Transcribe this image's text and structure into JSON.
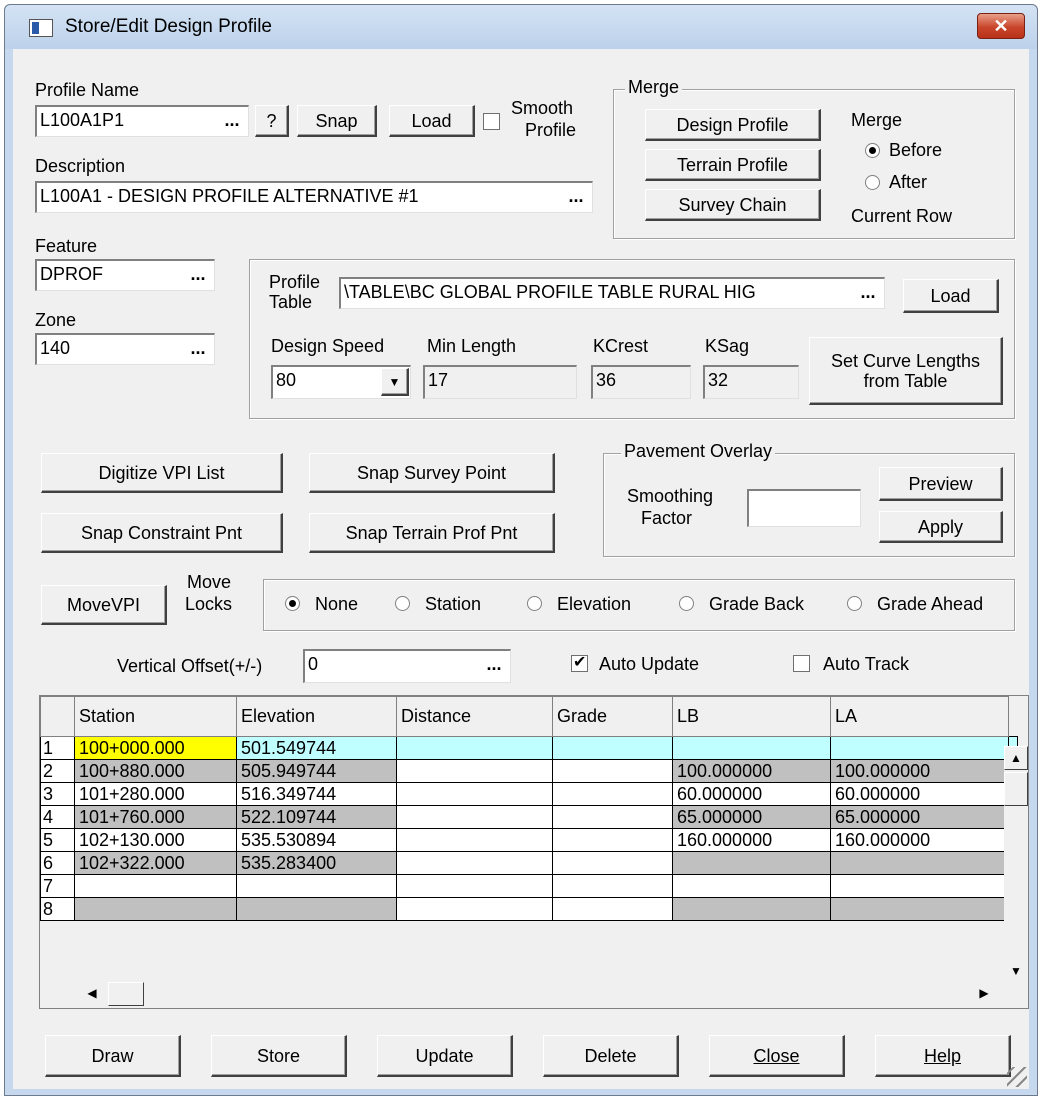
{
  "window": {
    "title": "Store/Edit Design Profile",
    "close_glyph": "✕"
  },
  "profile": {
    "name_label": "Profile Name",
    "name_value": "L100A1P1",
    "ellipsis": "...",
    "help_label": "?",
    "snap_label": "Snap",
    "load_label": "Load",
    "smooth_label_1": "Smooth",
    "smooth_label_2": "Profile",
    "smooth_checked": false,
    "description_label": "Description",
    "description_value": "L100A1 - DESIGN PROFILE ALTERNATIVE #1"
  },
  "merge": {
    "group_title": "Merge",
    "design_profile_label": "Design Profile",
    "terrain_profile_label": "Terrain Profile",
    "survey_chain_label": "Survey Chain",
    "merge_label": "Merge",
    "before_label": "Before",
    "after_label": "After",
    "current_row_label": "Current Row",
    "selected": "Before"
  },
  "feature": {
    "label": "Feature",
    "value": "DPROF"
  },
  "zone": {
    "label": "Zone",
    "value": "140"
  },
  "profile_table": {
    "label_1": "Profile",
    "label_2": "Table",
    "value": "\\TABLE\\BC GLOBAL PROFILE TABLE RURAL HIG",
    "load_label": "Load",
    "design_speed_label": "Design Speed",
    "design_speed_value": "80",
    "min_length_label": "Min Length",
    "min_length_value": "17",
    "kcrest_label": "KCrest",
    "kcrest_value": "36",
    "ksag_label": "KSag",
    "ksag_value": "32",
    "set_curve_label_1": "Set Curve Lengths",
    "set_curve_label_2": "from Table"
  },
  "buttons": {
    "digitize_vpi": "Digitize VPI List",
    "snap_survey_point": "Snap Survey Point",
    "snap_constraint": "Snap Constraint Pnt",
    "snap_terrain": "Snap Terrain Prof Pnt",
    "move_vpi": "MoveVPI"
  },
  "pavement": {
    "group_title": "Pavement Overlay",
    "smoothing_label_1": "Smoothing",
    "smoothing_label_2": "Factor",
    "smoothing_value": "",
    "preview_label": "Preview",
    "apply_label": "Apply"
  },
  "move_locks": {
    "label_1": "Move",
    "label_2": "Locks",
    "options": [
      "None",
      "Station",
      "Elevation",
      "Grade Back",
      "Grade Ahead"
    ],
    "selected": "None"
  },
  "offset": {
    "label": "Vertical Offset(+/-)",
    "value": "0",
    "auto_update_label": "Auto Update",
    "auto_update_checked": true,
    "auto_track_label": "Auto Track",
    "auto_track_checked": false
  },
  "grid": {
    "columns": [
      "Station",
      "Elevation",
      "Distance",
      "Grade",
      "LB",
      "LA"
    ],
    "rows": [
      {
        "n": "1",
        "cells": [
          "100+000.000",
          "501.549744",
          "",
          "",
          "",
          ""
        ]
      },
      {
        "n": "2",
        "cells": [
          "100+880.000",
          "505.949744",
          "",
          "",
          "100.000000",
          "100.000000"
        ]
      },
      {
        "n": "3",
        "cells": [
          "101+280.000",
          "516.349744",
          "",
          "",
          "60.000000",
          "60.000000"
        ]
      },
      {
        "n": "4",
        "cells": [
          "101+760.000",
          "522.109744",
          "",
          "",
          "65.000000",
          "65.000000"
        ]
      },
      {
        "n": "5",
        "cells": [
          "102+130.000",
          "535.530894",
          "",
          "",
          "160.000000",
          "160.000000"
        ]
      },
      {
        "n": "6",
        "cells": [
          "102+322.000",
          "535.283400",
          "",
          "",
          "",
          ""
        ]
      },
      {
        "n": "7",
        "cells": [
          "",
          "",
          "",
          "",
          "",
          ""
        ]
      },
      {
        "n": "8",
        "cells": [
          "",
          "",
          "",
          "",
          "",
          ""
        ]
      }
    ],
    "colors": {
      "selected_row": "#c0ffff",
      "active_cell": "#ffff00",
      "even_row": "#c0c0c0",
      "odd_row": "#ffffff"
    }
  },
  "footer": {
    "draw": "Draw",
    "store": "Store",
    "update": "Update",
    "delete": "Delete",
    "close": "Close",
    "help": "Help"
  }
}
